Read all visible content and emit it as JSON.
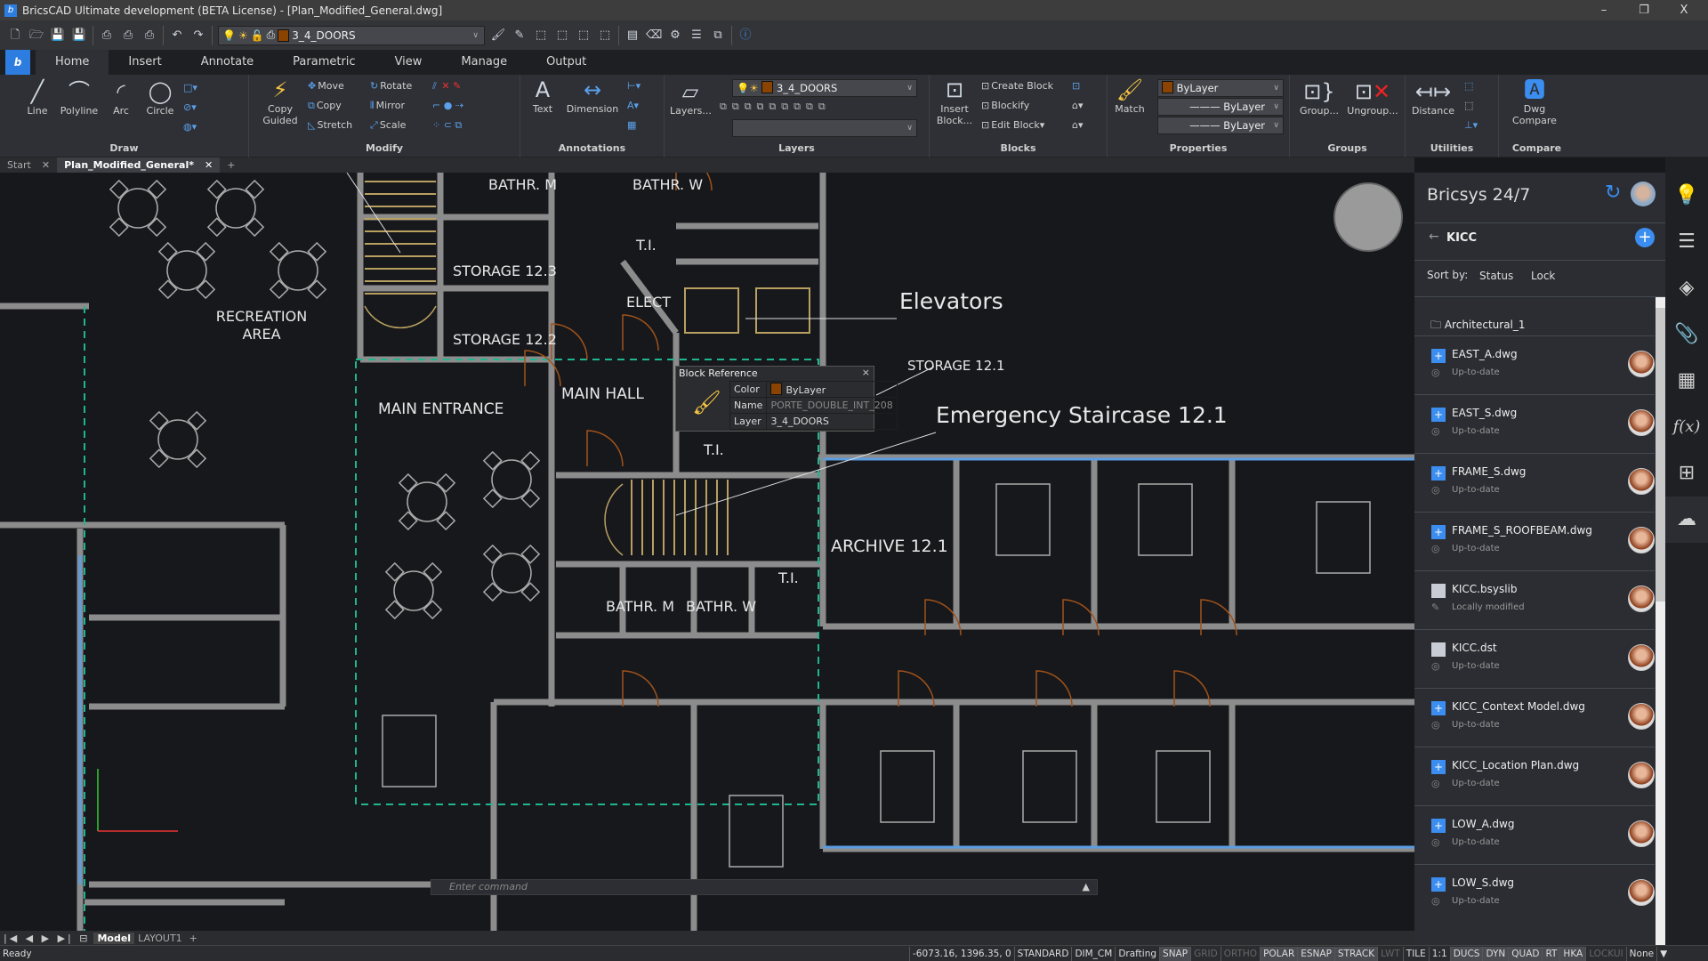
{
  "window": {
    "title": "BricsCAD Ultimate development (BETA License) - [Plan_Modified_General.dwg]",
    "minimize": "–",
    "restore": "❐",
    "close": "X"
  },
  "qat": {
    "current_layer": "3_4_DOORS"
  },
  "ribbon": {
    "tabs": [
      "Home",
      "Insert",
      "Annotate",
      "Parametric",
      "View",
      "Manage",
      "Output"
    ],
    "active_tab": "Home",
    "draw": {
      "title": "Draw",
      "line": "Line",
      "polyline": "Polyline",
      "arc": "Arc",
      "circle": "Circle"
    },
    "modify": {
      "title": "Modify",
      "copy_guided": "Copy Guided",
      "move": "Move",
      "copy": "Copy",
      "stretch": "Stretch",
      "rotate": "Rotate",
      "mirror": "Mirror",
      "scale": "Scale"
    },
    "annotations": {
      "title": "Annotations",
      "text": "Text",
      "dimension": "Dimension"
    },
    "layers": {
      "title": "Layers",
      "layers_btn": "Layers...",
      "current": "3_4_DOORS",
      "second": ""
    },
    "blocks": {
      "title": "Blocks",
      "insert": "Insert Block...",
      "create": "Create Block",
      "blockify": "Blockify",
      "edit": "Edit Block"
    },
    "properties": {
      "title": "Properties",
      "match": "Match",
      "color": "ByLayer",
      "linetype": "ByLayer",
      "lineweight": "ByLayer"
    },
    "groups": {
      "title": "Groups",
      "group": "Group...",
      "ungroup": "Ungroup..."
    },
    "utilities": {
      "title": "Utilities",
      "distance": "Distance"
    },
    "compare": {
      "title": "Compare",
      "dwg_compare": "Dwg Compare"
    }
  },
  "doc_tabs": [
    {
      "label": "Start"
    },
    {
      "label": "Plan_Modified_General*",
      "active": true
    }
  ],
  "drawing": {
    "labels": {
      "bathr_m1": "BATHR. M",
      "bathr_w1": "BATHR. W",
      "recreation": "RECREATION AREA",
      "storage123": "STORAGE 12.3",
      "storage122": "STORAGE 12.2",
      "ti1": "T.I.",
      "elect": "ELECT",
      "elevators": "Elevators",
      "storage121": "STORAGE 12.1",
      "main_entrance": "MAIN ENTRANCE",
      "main_hall": "MAIN HALL",
      "emergency": "Emergency Staircase 12.1",
      "ti2": "T.I.",
      "archive": "ARCHIVE 12.1",
      "ti3": "T.I.",
      "bathr_m2": "BATHR. M",
      "bathr_w2": "BATHR. W"
    },
    "colors": {
      "wall": "#8c8c8c",
      "door": "#a0521a",
      "stair": "#b8a060",
      "boundary": "#1fb58f",
      "window": "#5a9de0"
    }
  },
  "block_reference": {
    "title": "Block Reference",
    "close": "×",
    "color_label": "Color",
    "color_value": "ByLayer",
    "name_label": "Name",
    "name_value": "PORTE_DOUBLE_INT_208",
    "layer_label": "Layer",
    "layer_value": "3_4_DOORS",
    "swatch": "#8a4300"
  },
  "command": {
    "placeholder": "Enter command"
  },
  "layout_tabs": [
    "Model",
    "LAYOUT1",
    "+"
  ],
  "status": {
    "ready": "Ready",
    "coords": "-6073.16, 1396.35, 0",
    "items": [
      {
        "t": "STANDARD",
        "s": "n"
      },
      {
        "t": "DIM_CM",
        "s": "n"
      },
      {
        "t": "Drafting",
        "s": "n"
      },
      {
        "t": "SNAP",
        "s": "on"
      },
      {
        "t": "GRID",
        "s": "off"
      },
      {
        "t": "ORTHO",
        "s": "off"
      },
      {
        "t": "POLAR",
        "s": "on"
      },
      {
        "t": "ESNAP",
        "s": "on"
      },
      {
        "t": "STRACK",
        "s": "on"
      },
      {
        "t": "LWT",
        "s": "off"
      },
      {
        "t": "TILE",
        "s": "n"
      },
      {
        "t": "1:1",
        "s": "n"
      },
      {
        "t": "DUCS",
        "s": "on"
      },
      {
        "t": "DYN",
        "s": "on"
      },
      {
        "t": "QUAD",
        "s": "on"
      },
      {
        "t": "RT",
        "s": "on"
      },
      {
        "t": "HKA",
        "s": "on"
      },
      {
        "t": "LOCKUI",
        "s": "off"
      },
      {
        "t": "None",
        "s": "n"
      }
    ]
  },
  "bricsys247": {
    "title": "Bricsys 24/7",
    "project": "KICC",
    "sort_label": "Sort by:",
    "sort_status": "Status",
    "sort_lock": "Lock",
    "folder": "Architectural_1",
    "files": [
      {
        "name": "EAST_A.dwg",
        "status": "Up-to-date",
        "type": "dwg"
      },
      {
        "name": "EAST_S.dwg",
        "status": "Up-to-date",
        "type": "dwg"
      },
      {
        "name": "FRAME_S.dwg",
        "status": "Up-to-date",
        "type": "dwg"
      },
      {
        "name": "FRAME_S_ROOFBEAM.dwg",
        "status": "Up-to-date",
        "type": "dwg"
      },
      {
        "name": "KICC.bsyslib",
        "status": "Locally modified",
        "type": "doc"
      },
      {
        "name": "KICC.dst",
        "status": "Up-to-date",
        "type": "doc"
      },
      {
        "name": "KICC_Context Model.dwg",
        "status": "Up-to-date",
        "type": "dwg"
      },
      {
        "name": "KICC_Location Plan.dwg",
        "status": "Up-to-date",
        "type": "dwg"
      },
      {
        "name": "LOW_A.dwg",
        "status": "Up-to-date",
        "type": "dwg"
      },
      {
        "name": "LOW_S.dwg",
        "status": "Up-to-date",
        "type": "dwg"
      }
    ],
    "accent": "#3b8ef0"
  },
  "side_strip": [
    "lightbulb-icon",
    "sliders-icon",
    "layers-icon",
    "paperclip-icon",
    "grid-icon",
    "function-icon",
    "tree-icon",
    "cloud-upload-icon"
  ]
}
